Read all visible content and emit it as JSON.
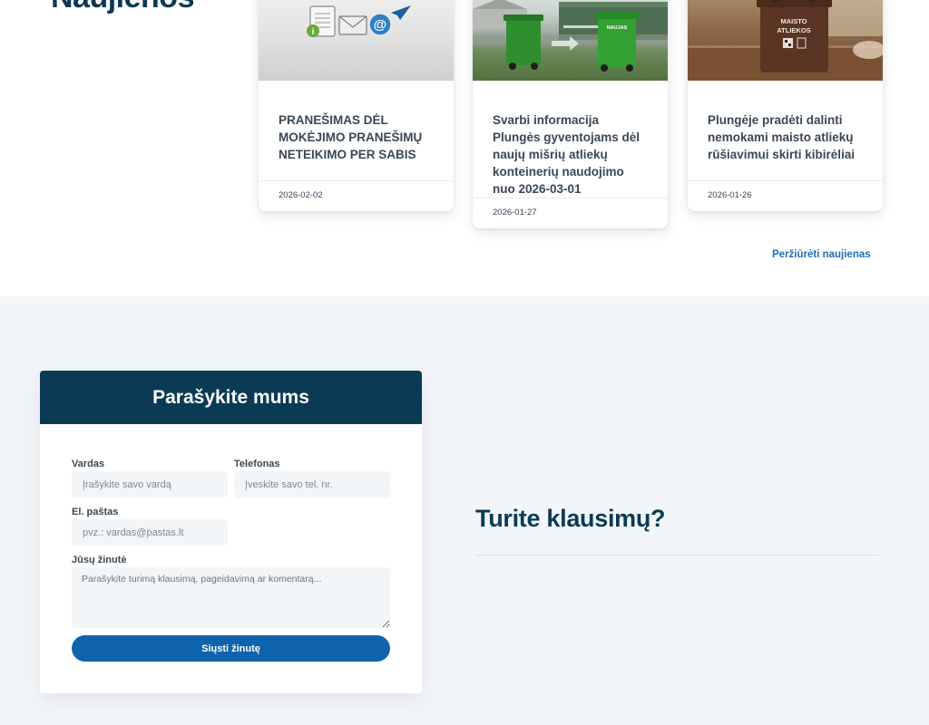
{
  "news": {
    "heading": "Naujienos",
    "cards": [
      {
        "title": "PRANEŠIMAS DĖL MOKĖJIMO PRANEŠIMŲ NETEIKIMO PER SABIS",
        "date": "2026-02-02"
      },
      {
        "title": "Svarbi informacija Plungės gyventojams dėl naujų mišrių atliekų konteinerių naudojimo nuo 2026-03-01",
        "date": "2026-01-27",
        "bin_text": "NAUJAS"
      },
      {
        "title": "Plungėje pradėti dalinti nemokami maisto atliekų rūšiavimui skirti kibirėliai",
        "date": "2026-01-26",
        "bin_text": "MAISTO ATLIEKOS"
      }
    ],
    "see_more": "Peržiūrėti naujienas"
  },
  "contact": {
    "form_title": "Parašykite mums",
    "name_label": "Vardas",
    "name_placeholder": "Įrašykite savo vardą",
    "phone_label": "Telefonas",
    "phone_placeholder": "Įveskite savo tel. nr.",
    "email_label": "El. paštas",
    "email_placeholder": "pvz.: vardas@pastas.lt",
    "message_label": "Jūsų žinutė",
    "message_placeholder": "Parašykite turimą klausimą, pageidavimą ar komentarą...",
    "submit_label": "Siųsti žinutę"
  },
  "faq": {
    "title": "Turite klausimų?"
  },
  "colors": {
    "primary_dark": "#0b3a55",
    "button_blue": "#0f63ac",
    "link_blue": "#1f6fb0",
    "section_bg": "#f3f6f9"
  }
}
